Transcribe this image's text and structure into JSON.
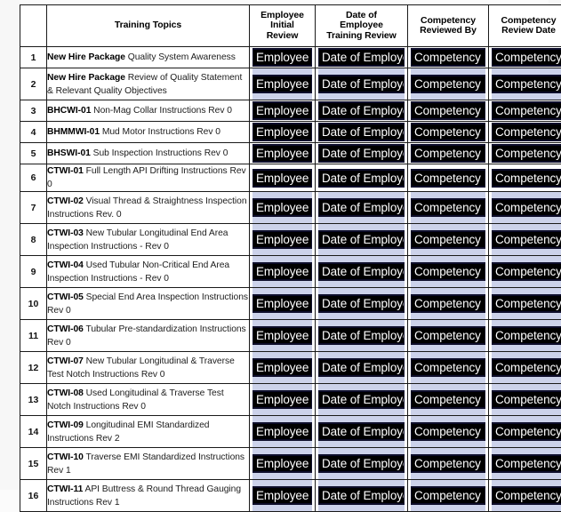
{
  "document": {
    "type": "training-records-form",
    "field_colors": {
      "field_background": "#000000",
      "field_text": "#ffffff",
      "field_filler": "#ccd2ea",
      "table_border": "#1a1a1a",
      "page_background": "#fbfbfb"
    }
  },
  "table": {
    "headers": [
      {
        "id": "row-number",
        "lines": [
          ""
        ]
      },
      {
        "id": "training-topics",
        "lines": [
          "Training Topics"
        ]
      },
      {
        "id": "employee-initial-review",
        "lines": [
          "Employee",
          "Initial",
          "Review"
        ]
      },
      {
        "id": "date-of-employee-training-review",
        "lines": [
          "Date of",
          "Employee",
          "Training Review"
        ]
      },
      {
        "id": "competency-reviewed-by",
        "lines": [
          "Competency",
          "Reviewed By"
        ]
      },
      {
        "id": "competency-review-date",
        "lines": [
          "Competency",
          "Review Date"
        ]
      }
    ],
    "field_values": {
      "employee_initial_review": "Employee",
      "date_of_employee_training_review": "Date of Employee Training Review",
      "competency_reviewed_by": "Competency Reviewed By",
      "competency_review_date": "Competency Review Date"
    },
    "rows": [
      {
        "num": "1",
        "code": "New Hire Package",
        "text": " Quality System Awareness",
        "lines": 1
      },
      {
        "num": "2",
        "code": "New Hire Package",
        "text": " Review of Quality Statement & Relevant Quality Objectives",
        "lines": 2
      },
      {
        "num": "3",
        "code": "BHCWI-01",
        "text": " Non-Mag Collar Instructions Rev 0",
        "lines": 1
      },
      {
        "num": "4",
        "code": "BHMMWI-01",
        "text": " Mud Motor Instructions Rev 0",
        "lines": 1
      },
      {
        "num": "5",
        "code": "BHSWI-01",
        "text": " Sub Inspection Instructions Rev 0",
        "lines": 1
      },
      {
        "num": "6",
        "code": "CTWI-01",
        "text": " Full Length API Drifting Instructions Rev 0",
        "lines": 1
      },
      {
        "num": "7",
        "code": "CTWI-02",
        "text": " Visual Thread & Straightness Inspection Instructions Rev. 0",
        "lines": 2
      },
      {
        "num": "8",
        "code": "CTWI-03",
        "text": " New Tubular Longitudinal End Area Inspection Instructions - Rev 0",
        "lines": 2
      },
      {
        "num": "9",
        "code": "CTWI-04",
        "text": " Used Tubular Non-Critical End Area Inspection Instructions - Rev 0",
        "lines": 2
      },
      {
        "num": "10",
        "code": "CTWI-05",
        "text": " Special End Area Inspection Instructions Rev 0",
        "lines": 2
      },
      {
        "num": "11",
        "code": "CTWI-06",
        "text": " Tubular Pre-standardization Instructions Rev 0",
        "lines": 2
      },
      {
        "num": "12",
        "code": "CTWI-07",
        "text": " New Tubular Longitudinal & Traverse Test Notch Instructions Rev 0",
        "lines": 2
      },
      {
        "num": "13",
        "code": "CTWI-08",
        "text": " Used Longitudinal & Traverse Test Notch Instructions Rev 0",
        "lines": 2
      },
      {
        "num": "14",
        "code": "CTWI-09",
        "text": " Longitudinal EMI Standardized Instructions Rev 2",
        "lines": 2
      },
      {
        "num": "15",
        "code": "CTWI-10",
        "text": " Traverse EMI Standardized Instructions Rev 1",
        "lines": 2
      },
      {
        "num": "16",
        "code": "CTWI-11",
        "text": " API Buttress & Round Thread Gauging Instructions Rev 1",
        "lines": 2
      }
    ]
  }
}
